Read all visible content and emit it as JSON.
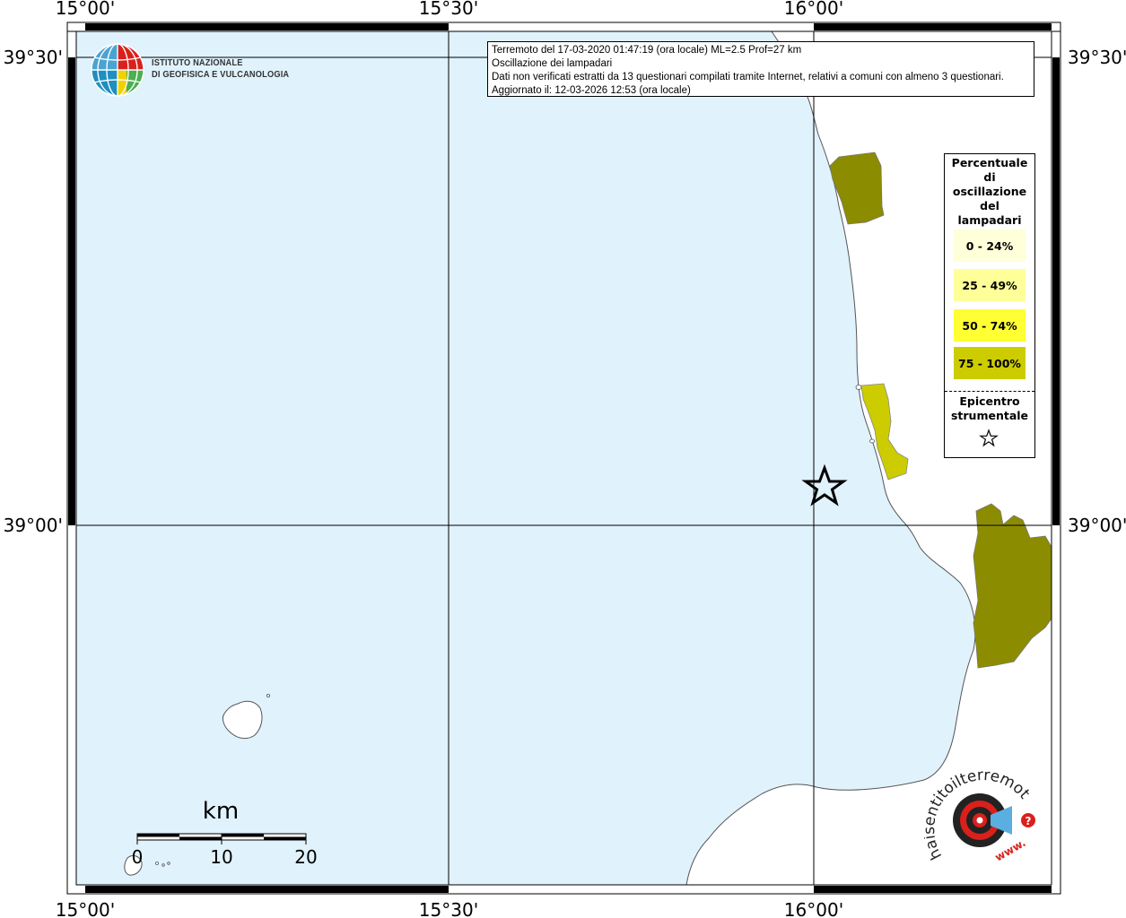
{
  "info": {
    "line1": "Terremoto del 17-03-2020 01:47:19 (ora locale) ML=2.5 Prof=27 km",
    "line2": "Oscillazione dei lampadari",
    "line3": "Dati non verificati estratti da 13 questionari compilati tramite Internet, relativi a comuni con almeno 3 questionari.",
    "line4": "Aggiornato il: 12-03-2026 12:53 (ora locale)"
  },
  "logo": {
    "line1": "ISTITUTO NAZIONALE",
    "line2": "DI GEOFISICA E VULCANOLOGIA"
  },
  "axes": {
    "lon_labels": [
      "15°00'",
      "15°30'",
      "16°00'"
    ],
    "lat_labels": [
      "39°30'",
      "39°00'"
    ]
  },
  "legend": {
    "title_lines": [
      "Percentuale",
      "di",
      "oscillazione",
      "del",
      "lampadari"
    ],
    "classes": [
      {
        "label": "0 - 24%",
        "color": "#ffffd9"
      },
      {
        "label": "25 - 49%",
        "color": "#ffff99"
      },
      {
        "label": "50 - 74%",
        "color": "#ffff33"
      },
      {
        "label": "75 - 100%",
        "color": "#cccc00"
      }
    ],
    "epicentro_lines": [
      "Epicentro",
      "strumentale"
    ]
  },
  "scale": {
    "title": "km",
    "ticks": [
      "0",
      "10",
      "20"
    ]
  },
  "branding": {
    "hst_text": "haisentitoilterremoto.it",
    "hst_www": "www."
  },
  "colors": {
    "sea": "#e0f2fc",
    "land": "#ffffff",
    "dark_olive": "#8c8c00",
    "yellow_olive": "#cccc00",
    "brand_red": "#d9201c"
  }
}
